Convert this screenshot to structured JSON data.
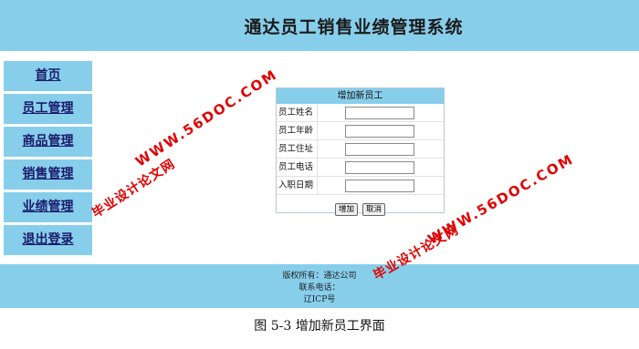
{
  "header": {
    "title": "通达员工销售业绩管理系统"
  },
  "nav": {
    "items": [
      {
        "label": "首页"
      },
      {
        "label": "员工管理"
      },
      {
        "label": "商品管理"
      },
      {
        "label": "销售管理"
      },
      {
        "label": "业绩管理"
      },
      {
        "label": "退出登录"
      }
    ]
  },
  "form": {
    "heading": "增加新员工",
    "fields": [
      {
        "label": "员工姓名",
        "value": ""
      },
      {
        "label": "员工年龄",
        "value": ""
      },
      {
        "label": "员工住址",
        "value": ""
      },
      {
        "label": "员工电话",
        "value": ""
      },
      {
        "label": "入职日期",
        "value": ""
      }
    ],
    "add_label": "增加",
    "cancel_label": "取消"
  },
  "footer": {
    "copyright": "版权所有：通达公司",
    "contact": "联系电话：",
    "icp": "辽ICP号"
  },
  "caption": "图 5-3  增加新员工界面",
  "watermarks": {
    "url": "WWW.56DOC.COM",
    "site": "毕业设计论文网",
    "color": "#e00000"
  },
  "colors": {
    "accent": "#87ceeb"
  }
}
